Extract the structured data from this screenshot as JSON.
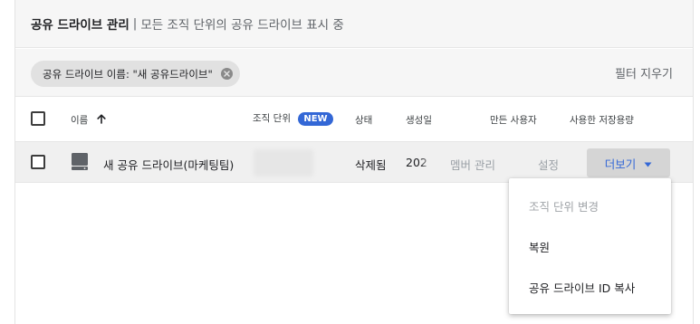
{
  "header": {
    "title": "공유 드라이브 관리",
    "separator": "|",
    "subtitle": "모든 조직 단위의 공유 드라이브 표시 중"
  },
  "filter": {
    "chip_label": "공유 드라이브 이름: \"새 공유드라이브\"",
    "clear_label": "필터 지우기"
  },
  "columns": {
    "name": "이름",
    "org_unit": "조직 단위",
    "new_badge": "NEW",
    "status": "상태",
    "created": "생성일",
    "creator": "만든 사용자",
    "storage": "사용한 저장용량"
  },
  "row": {
    "name": "새 공유 드라이브(마케팅팀)",
    "status": "삭제됨",
    "created": "202",
    "action_members": "멤버 관리",
    "action_settings": "설정",
    "more_label": "더보기"
  },
  "menu": {
    "items": [
      {
        "label": "조직 단위 변경",
        "disabled": true
      },
      {
        "label": "복원",
        "disabled": false
      },
      {
        "label": "공유 드라이브 ID 복사",
        "disabled": false
      }
    ]
  },
  "colors": {
    "accent": "#3367d6",
    "header_bg": "#f6f6f6",
    "row_bg": "#f0f0f0"
  }
}
